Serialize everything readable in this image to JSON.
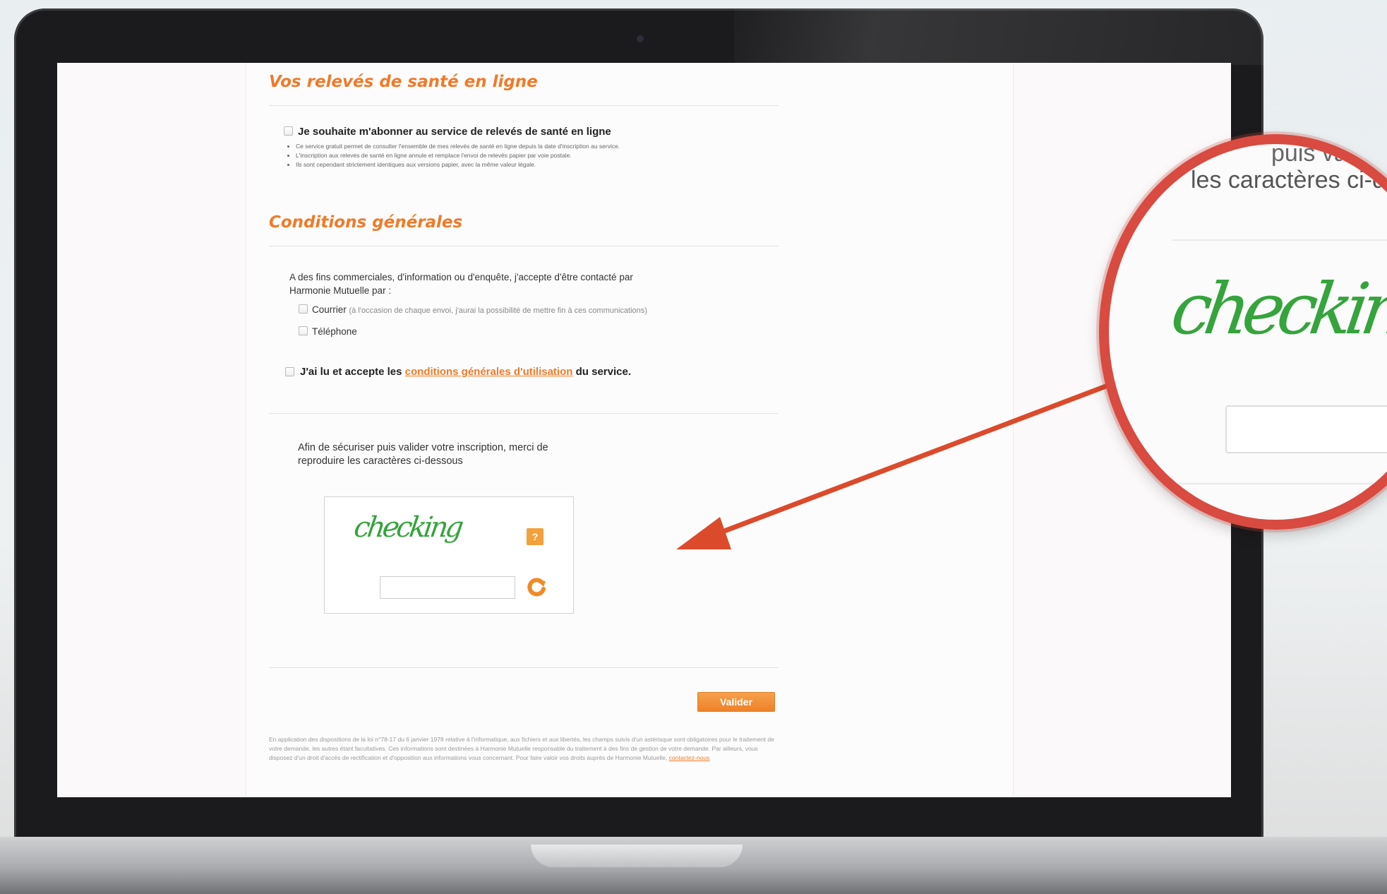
{
  "section1": {
    "title": "Vos relevés de santé en ligne",
    "subscribe_label": "Je souhaite m'abonner au service de relevés de santé en ligne",
    "bullets": [
      "Ce service gratuit permet de consulter l'ensemble de mes relevés de santé en ligne depuis la date d'inscription au service.",
      "L'inscription aux relevés de santé en ligne annule et remplace l'envoi de relevés papier par voie postale.",
      "Ils sont cependant strictement identiques aux versions papier, avec la même valeur légale."
    ]
  },
  "section2": {
    "title": "Conditions générales",
    "contact_intro": "A des fins commerciales, d'information ou d'enquête, j'accepte d'être contacté par Harmonie Mutuelle par :",
    "courrier_label": "Courrier",
    "courrier_note": "(à l'occasion de chaque envoi, j'aurai la possibilité de mettre fin à ces communications)",
    "telephone_label": "Téléphone",
    "terms_prefix": "J'ai lu et accepte les",
    "terms_link": "conditions générales d'utilisation",
    "terms_suffix": "du service."
  },
  "captcha": {
    "instruction": "Afin de sécuriser puis valider votre inscription, merci de reproduire les caractères ci-dessous",
    "word": "checking",
    "help_label": "?",
    "input_value": ""
  },
  "submit_label": "Valider",
  "legal": {
    "text": "En application des dispositions de la loi n°78-17 du 6 janvier 1978 relative à l'informatique, aux fichiers et aux libertés, les champs suivis d'un astérisque sont obligatoires pour le traitement de votre demande, les autres étant facultatives. Ces informations sont destinées à Harmonie Mutuelle responsable du traitement à des fins de gestion de votre demande. Par ailleurs, vous disposez d'un droit d'accès de rectification et d'opposition aux informations vous concernant. Pour faire valoir vos droits auprès de Harmonie Mutuelle,",
    "link": "contactez-nous"
  },
  "magnifier": {
    "line1": "puis valid",
    "line2": "les caractères ci-des",
    "captcha_word": "checking"
  },
  "colors": {
    "accent": "#f07a28",
    "captcha_green": "#35a43c",
    "magnifier_ring": "#d94a40",
    "arrow": "#dc4a2c"
  }
}
